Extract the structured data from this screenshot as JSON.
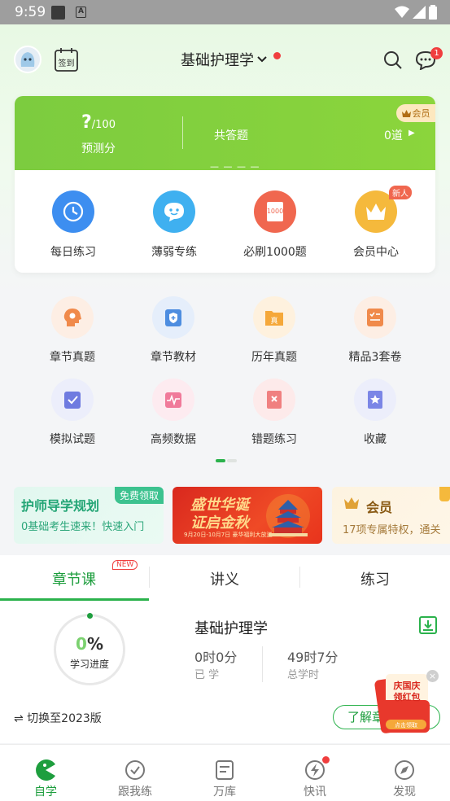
{
  "status_bar": {
    "time": "9:59",
    "a_icon": "A"
  },
  "header": {
    "signin_label": "签到",
    "subject": "基础护理学",
    "message_count": "1"
  },
  "score_card": {
    "predicted_value": "?",
    "predicted_max": "/100",
    "predicted_label": "预测分",
    "answered_label": "共答题",
    "answered_value": "0道",
    "vip_label": "会员",
    "dashes": "— — — —"
  },
  "quick_actions": [
    {
      "label": "每日练习",
      "icon": "clock-icon",
      "color": "#3d8ef0"
    },
    {
      "label": "薄弱专练",
      "icon": "chat-bubble-icon",
      "color": "#3fb0f0"
    },
    {
      "label": "必刷1000题",
      "icon": "book-1000-icon",
      "color": "#f0674f",
      "book_text": "1000"
    },
    {
      "label": "会员中心",
      "icon": "crown-icon",
      "color": "#f5b93c",
      "tag": "新人"
    }
  ],
  "grid": [
    {
      "label": "章节真题",
      "icon": "head-gear-icon"
    },
    {
      "label": "章节教材",
      "icon": "shield-book-icon"
    },
    {
      "label": "历年真题",
      "icon": "folder-icon",
      "icon_text": "真"
    },
    {
      "label": "精品3套卷",
      "icon": "checklist-icon"
    },
    {
      "label": "模拟试题",
      "icon": "clipboard-check-icon"
    },
    {
      "label": "高频数据",
      "icon": "pulse-icon"
    },
    {
      "label": "错题练习",
      "icon": "wrong-doc-icon"
    },
    {
      "label": "收藏",
      "icon": "star-doc-icon"
    }
  ],
  "banners": {
    "plan": {
      "title": "护师导学规划",
      "subtitle": "0基础考生速来！快速入门",
      "tag": "免费领取"
    },
    "promo": {
      "line1": "盛世华诞",
      "line2": "证启金秋",
      "small": "9月20日-10月7日 豪华福利大放送"
    },
    "vip": {
      "title": "会员",
      "subtitle": "17项专属特权，通关"
    }
  },
  "tabs": [
    {
      "label": "章节课",
      "badge": "NEW",
      "active": true
    },
    {
      "label": "讲义",
      "active": false
    },
    {
      "label": "练习",
      "active": false
    }
  ],
  "course": {
    "progress_value": "0",
    "progress_unit": "%",
    "progress_label": "学习进度",
    "title": "基础护理学",
    "studied_value": "0时0分",
    "studied_label": "已 学",
    "total_value": "49时7分",
    "total_label": "总学时",
    "switch_version": "⇌ 切换至2023版",
    "learn_button": "了解章节"
  },
  "red_packet": {
    "line1": "庆国庆",
    "line2": "领红包",
    "button": "点击领取"
  },
  "bottom_nav": [
    {
      "label": "自学",
      "icon": "pacman-icon",
      "active": true
    },
    {
      "label": "跟我练",
      "icon": "check-circle-icon",
      "active": false
    },
    {
      "label": "万库",
      "icon": "document-icon",
      "active": false
    },
    {
      "label": "快讯",
      "icon": "lightning-icon",
      "active": false
    },
    {
      "label": "发现",
      "icon": "compass-icon",
      "active": false
    }
  ],
  "colors": {
    "brand_green": "#2bb24c",
    "card_green": "#8bd53c",
    "alert_red": "#f03e3e"
  }
}
